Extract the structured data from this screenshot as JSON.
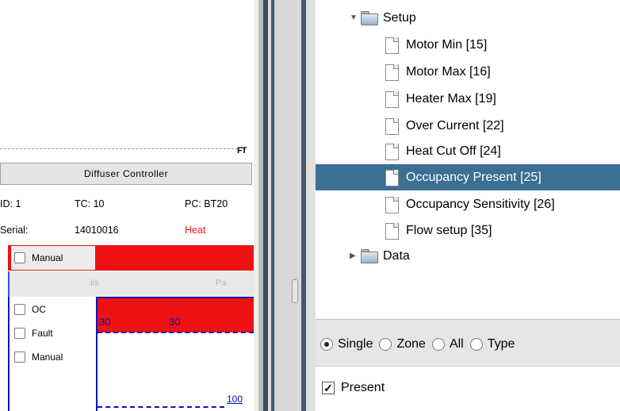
{
  "left_panel": {
    "ft_label": "FT",
    "header": "Diffuser Controller",
    "id_label": "ID: 1",
    "tc_label": "TC: 10",
    "pc_label": "PC: BT20",
    "serial_label": "Serial:",
    "serial_value": "14010016",
    "mode_label": "Heat",
    "manual_checkbox_label": "Manual",
    "units": {
      "flow": "l/s",
      "pressure": "Pa"
    },
    "checkboxes": [
      "OC",
      "Fault",
      "Manual"
    ],
    "graph": {
      "value_a": "30",
      "value_b": "30",
      "bottom_value": "100"
    }
  },
  "tree": {
    "root_label": "Setup",
    "items": [
      {
        "label": "Motor Min [15]"
      },
      {
        "label": "Motor Max [16]"
      },
      {
        "label": "Heater Max [19]"
      },
      {
        "label": "Over Current [22]"
      },
      {
        "label": "Heat Cut Off [24]"
      },
      {
        "label": "Occupancy Present [25]"
      },
      {
        "label": "Occupancy Sensitivity [26]"
      },
      {
        "label": "Flow setup [35]"
      }
    ],
    "selected_item": "Occupancy Present [25]",
    "data_folder_label": "Data"
  },
  "scope_options": {
    "options": [
      "Single",
      "Zone",
      "All",
      "Type"
    ],
    "selected": "Single"
  },
  "present_checkbox": {
    "label": "Present",
    "checked": true,
    "mark": "✓"
  },
  "colors": {
    "selection": "#3b6f94",
    "alarm_red": "#ee1111",
    "graph_blue": "#0a14c4",
    "heat_text": "#ee1c1c"
  }
}
